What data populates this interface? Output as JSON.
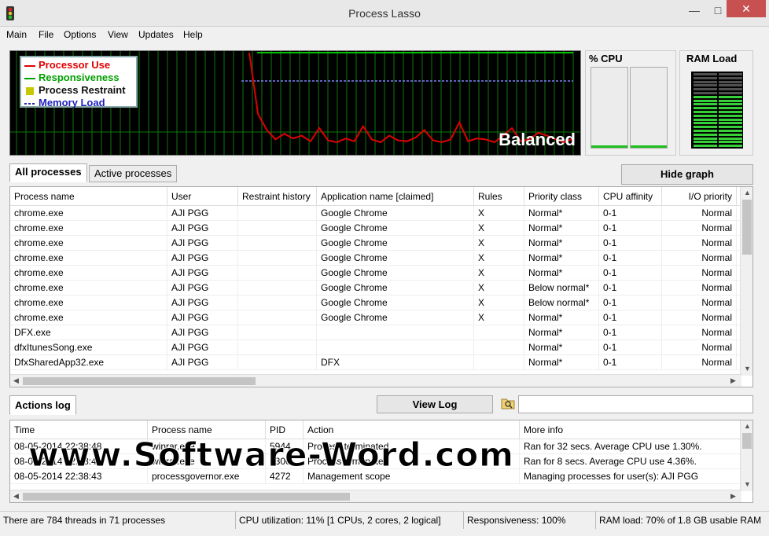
{
  "window": {
    "title": "Process Lasso",
    "min_glyph": "—",
    "max_glyph": "□",
    "close_glyph": "✕"
  },
  "menu": [
    "Main",
    "File",
    "Options",
    "View",
    "Updates",
    "Help"
  ],
  "graph": {
    "legend": [
      {
        "label": "Processor Use",
        "color": "#e00000",
        "style": "line"
      },
      {
        "label": "Responsiveness",
        "color": "#00a000",
        "style": "line"
      },
      {
        "label": "Process Restraint",
        "color": "#c8c800",
        "style": "box"
      },
      {
        "label": "Memory Load",
        "color": "#2020c0",
        "style": "dash"
      }
    ],
    "mode_label": "Balanced",
    "processor_use": [
      100,
      35,
      18,
      8,
      14,
      9,
      12,
      6,
      20,
      7,
      5,
      9,
      6,
      22,
      8,
      5,
      12,
      7,
      6,
      10,
      18,
      7,
      5,
      8,
      26,
      6,
      9,
      8,
      5,
      12,
      20,
      6,
      8,
      15,
      12,
      8,
      5,
      9
    ],
    "responsiveness_level": 100,
    "memory_load_level": 70
  },
  "cpu_panel": {
    "title": "% CPU",
    "cores": [
      3,
      3
    ]
  },
  "ram_panel": {
    "title": "RAM Load",
    "percent": 70
  },
  "tabs": {
    "all": "All processes",
    "active": "Active processes"
  },
  "hide_graph_label": "Hide graph",
  "process_table": {
    "columns": [
      "Process name",
      "User",
      "Restraint history",
      "Application name [claimed]",
      "Rules",
      "Priority class",
      "CPU affinity",
      "I/O priority"
    ],
    "rows": [
      [
        "chrome.exe",
        "AJI PGG",
        "",
        "Google Chrome",
        "X",
        "Normal*",
        "0-1",
        "Normal"
      ],
      [
        "chrome.exe",
        "AJI PGG",
        "",
        "Google Chrome",
        "X",
        "Normal*",
        "0-1",
        "Normal"
      ],
      [
        "chrome.exe",
        "AJI PGG",
        "",
        "Google Chrome",
        "X",
        "Normal*",
        "0-1",
        "Normal"
      ],
      [
        "chrome.exe",
        "AJI PGG",
        "",
        "Google Chrome",
        "X",
        "Normal*",
        "0-1",
        "Normal"
      ],
      [
        "chrome.exe",
        "AJI PGG",
        "",
        "Google Chrome",
        "X",
        "Normal*",
        "0-1",
        "Normal"
      ],
      [
        "chrome.exe",
        "AJI PGG",
        "",
        "Google Chrome",
        "X",
        "Below normal*",
        "0-1",
        "Normal"
      ],
      [
        "chrome.exe",
        "AJI PGG",
        "",
        "Google Chrome",
        "X",
        "Below normal*",
        "0-1",
        "Normal"
      ],
      [
        "chrome.exe",
        "AJI PGG",
        "",
        "Google Chrome",
        "X",
        "Normal*",
        "0-1",
        "Normal"
      ],
      [
        "DFX.exe",
        "AJI PGG",
        "",
        "",
        "",
        "Normal*",
        "0-1",
        "Normal"
      ],
      [
        "dfxItunesSong.exe",
        "AJI PGG",
        "",
        "",
        "",
        "Normal*",
        "0-1",
        "Normal"
      ],
      [
        "DfxSharedApp32.exe",
        "AJI PGG",
        "",
        "DFX",
        "",
        "Normal*",
        "0-1",
        "Normal"
      ]
    ]
  },
  "actions_log": {
    "tab_label": "Actions log",
    "view_log_label": "View Log",
    "search_icon": "folder-search-icon",
    "search_value": "",
    "columns": [
      "Time",
      "Process name",
      "PID",
      "Action",
      "More info"
    ],
    "rows": [
      [
        "08-05-2014 22:38:48",
        "winrar.exe",
        "5944",
        "Process terminated",
        "Ran for 32 secs. Average CPU use 1.30%."
      ],
      [
        "08-05-2014 22:38:43",
        "winrar.exe",
        "3300",
        "Process terminated",
        "Ran for 8 secs. Average CPU use 4.36%."
      ],
      [
        "08-05-2014 22:38:43",
        "processgovernor.exe",
        "4272",
        "Management scope",
        "Managing processes for user(s): AJI PGG"
      ]
    ]
  },
  "watermark": "www.Software-Word.com",
  "status": {
    "threads": "There are 784 threads in 71 processes",
    "cpu": "CPU utilization: 11% [1 CPUs, 2 cores, 2 logical]",
    "responsiveness": "Responsiveness: 100%",
    "ram": "RAM load: 70% of 1.8 GB usable RAM"
  },
  "colors": {
    "grid": "#0a7a0a",
    "cpu_line": "#e00000",
    "resp_line": "#00c000",
    "mem_line": "#8080ff",
    "ram_on": "#38d038",
    "ram_off": "#505050",
    "close": "#c75050"
  }
}
